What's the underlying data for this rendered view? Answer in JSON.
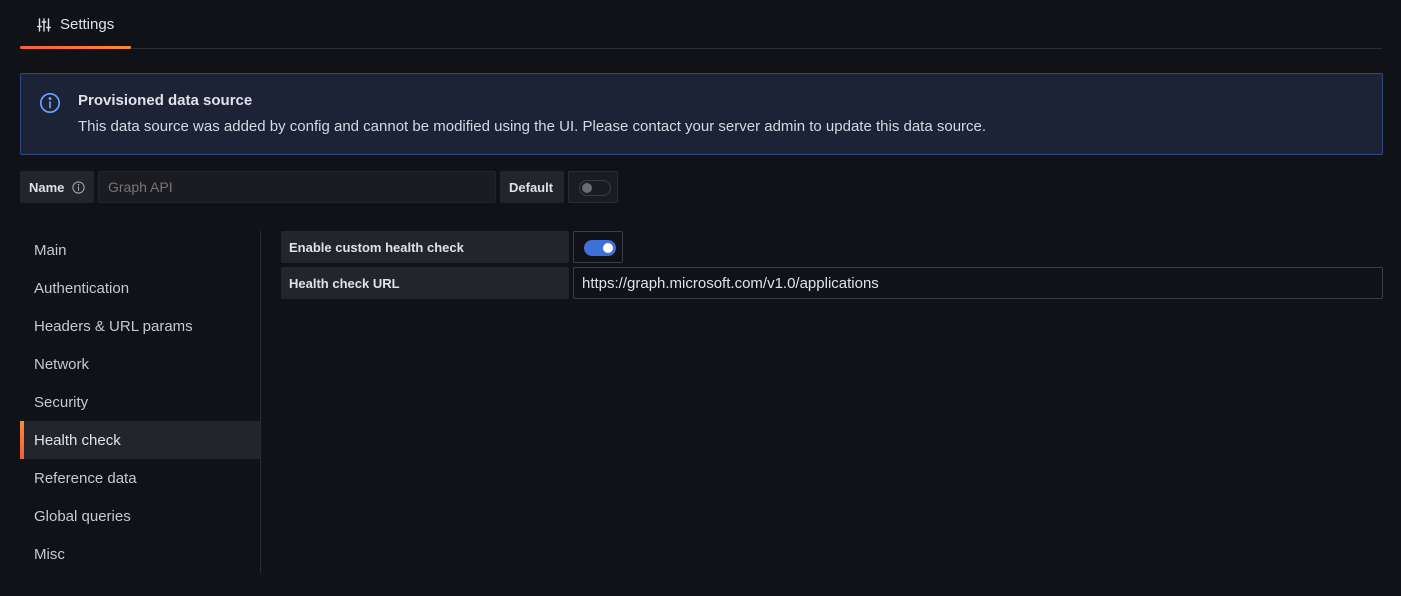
{
  "tabs": [
    {
      "label": "Settings",
      "icon": "sliders-icon",
      "active": true
    }
  ],
  "colors": {
    "accent": "#ff8833",
    "toggle_on": "#3d71d9",
    "banner_bg": "#1c2336",
    "banner_border": "#2f4a7f",
    "info_icon": "#6e9fff"
  },
  "banner": {
    "icon": "info-circle-icon",
    "title": "Provisioned data source",
    "text": "This data source was added by config and cannot be modified using the UI. Please contact your server admin to update this data source."
  },
  "name_field": {
    "label": "Name",
    "placeholder": "Graph API",
    "value": ""
  },
  "default_field": {
    "label": "Default",
    "enabled": false
  },
  "sidebar": {
    "items": [
      {
        "label": "Main",
        "active": false
      },
      {
        "label": "Authentication",
        "active": false
      },
      {
        "label": "Headers & URL params",
        "active": false
      },
      {
        "label": "Network",
        "active": false
      },
      {
        "label": "Security",
        "active": false
      },
      {
        "label": "Health check",
        "active": true
      },
      {
        "label": "Reference data",
        "active": false
      },
      {
        "label": "Global queries",
        "active": false
      },
      {
        "label": "Misc",
        "active": false
      }
    ]
  },
  "health_check": {
    "enable_label": "Enable custom health check",
    "enabled": true,
    "url_label": "Health check URL",
    "url_value": "https://graph.microsoft.com/v1.0/applications"
  }
}
